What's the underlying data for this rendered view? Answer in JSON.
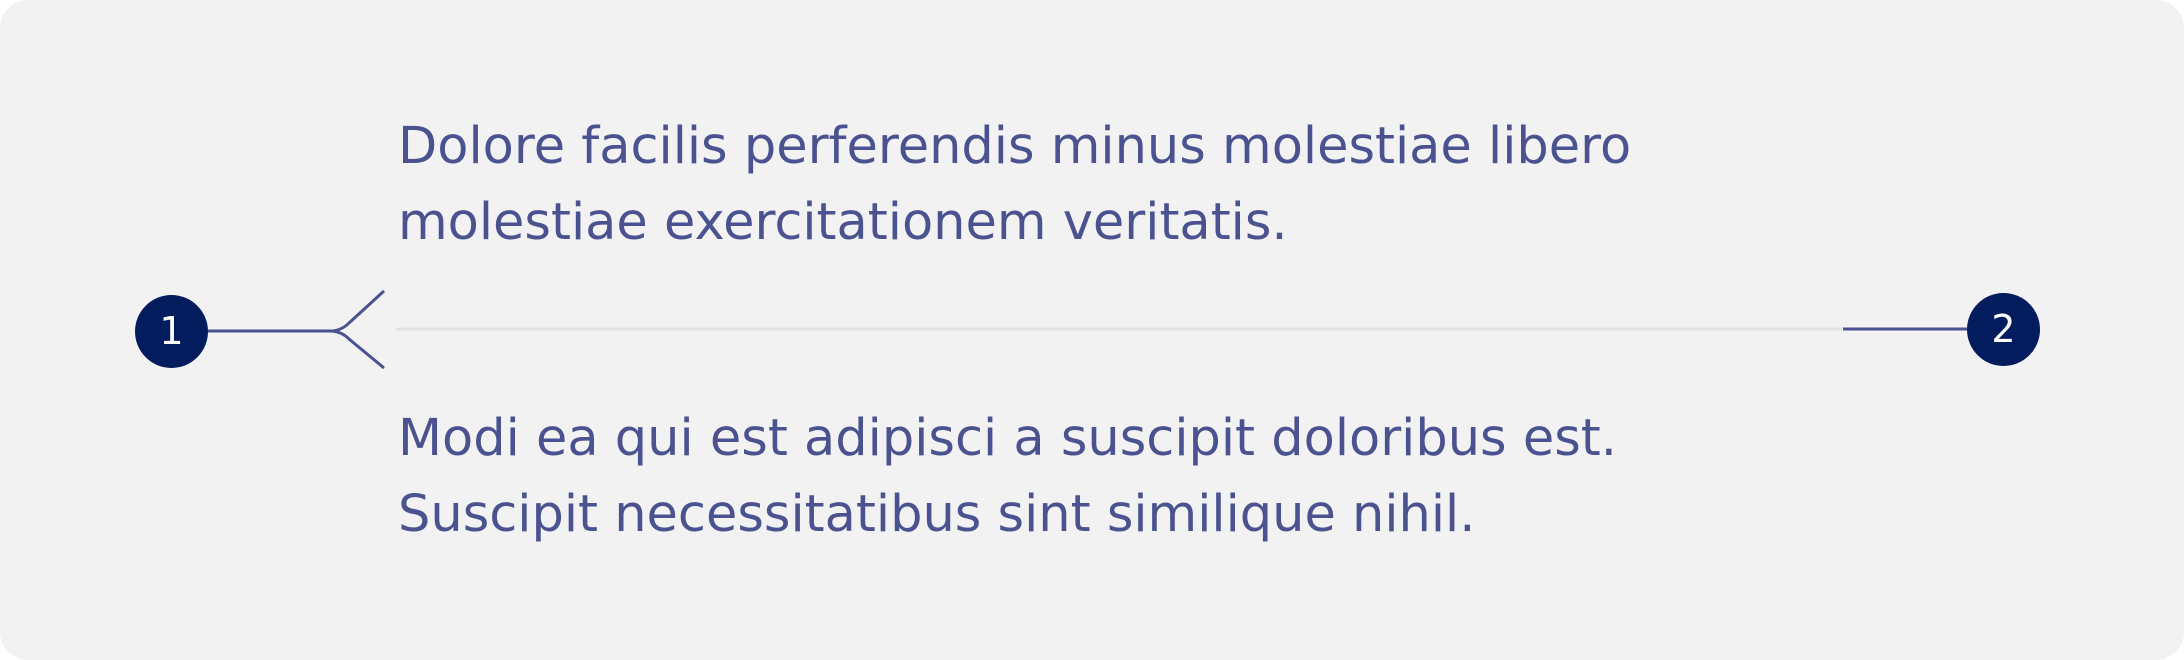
{
  "paragraphs": {
    "top": {
      "line1": "Dolore facilis perferendis minus molestiae libero",
      "line2": "molestiae exercitationem veritatis."
    },
    "bottom": {
      "line1": "Modi ea qui est adipisci a suscipit doloribus est.",
      "line2": "Suscipit necessitatibus sint similique nihil."
    }
  },
  "markers": {
    "start": "1",
    "end": "2"
  },
  "colors": {
    "background": "#f2f2f2",
    "text": "#4a5290",
    "marker": "#021c5e",
    "connector": "#4a5290",
    "divider": "#e1e1e1"
  }
}
